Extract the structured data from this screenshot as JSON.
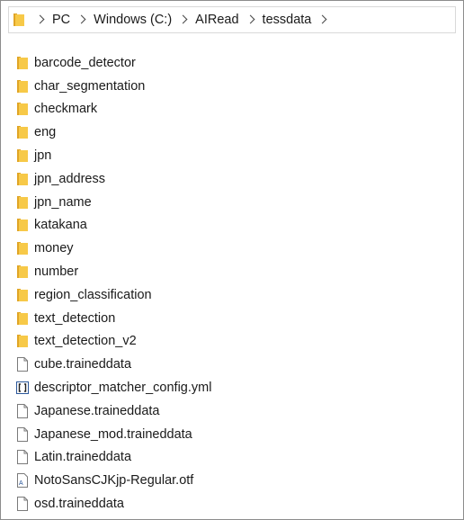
{
  "breadcrumb": [
    "PC",
    "Windows (C:)",
    "AIRead",
    "tessdata"
  ],
  "items": [
    {
      "name": "barcode_detector",
      "type": "folder"
    },
    {
      "name": "char_segmentation",
      "type": "folder"
    },
    {
      "name": "checkmark",
      "type": "folder"
    },
    {
      "name": "eng",
      "type": "folder"
    },
    {
      "name": "jpn",
      "type": "folder"
    },
    {
      "name": "jpn_address",
      "type": "folder"
    },
    {
      "name": "jpn_name",
      "type": "folder"
    },
    {
      "name": "katakana",
      "type": "folder"
    },
    {
      "name": "money",
      "type": "folder"
    },
    {
      "name": "number",
      "type": "folder"
    },
    {
      "name": "region_classification",
      "type": "folder"
    },
    {
      "name": "text_detection",
      "type": "folder"
    },
    {
      "name": "text_detection_v2",
      "type": "folder"
    },
    {
      "name": "cube.traineddata",
      "type": "file"
    },
    {
      "name": "descriptor_matcher_config.yml",
      "type": "yml"
    },
    {
      "name": "Japanese.traineddata",
      "type": "file"
    },
    {
      "name": "Japanese_mod.traineddata",
      "type": "file"
    },
    {
      "name": "Latin.traineddata",
      "type": "file"
    },
    {
      "name": "NotoSansCJKjp-Regular.otf",
      "type": "font"
    },
    {
      "name": "osd.traineddata",
      "type": "file"
    }
  ],
  "colors": {
    "folder": "#f7c948",
    "folder_dark": "#e0a526"
  }
}
